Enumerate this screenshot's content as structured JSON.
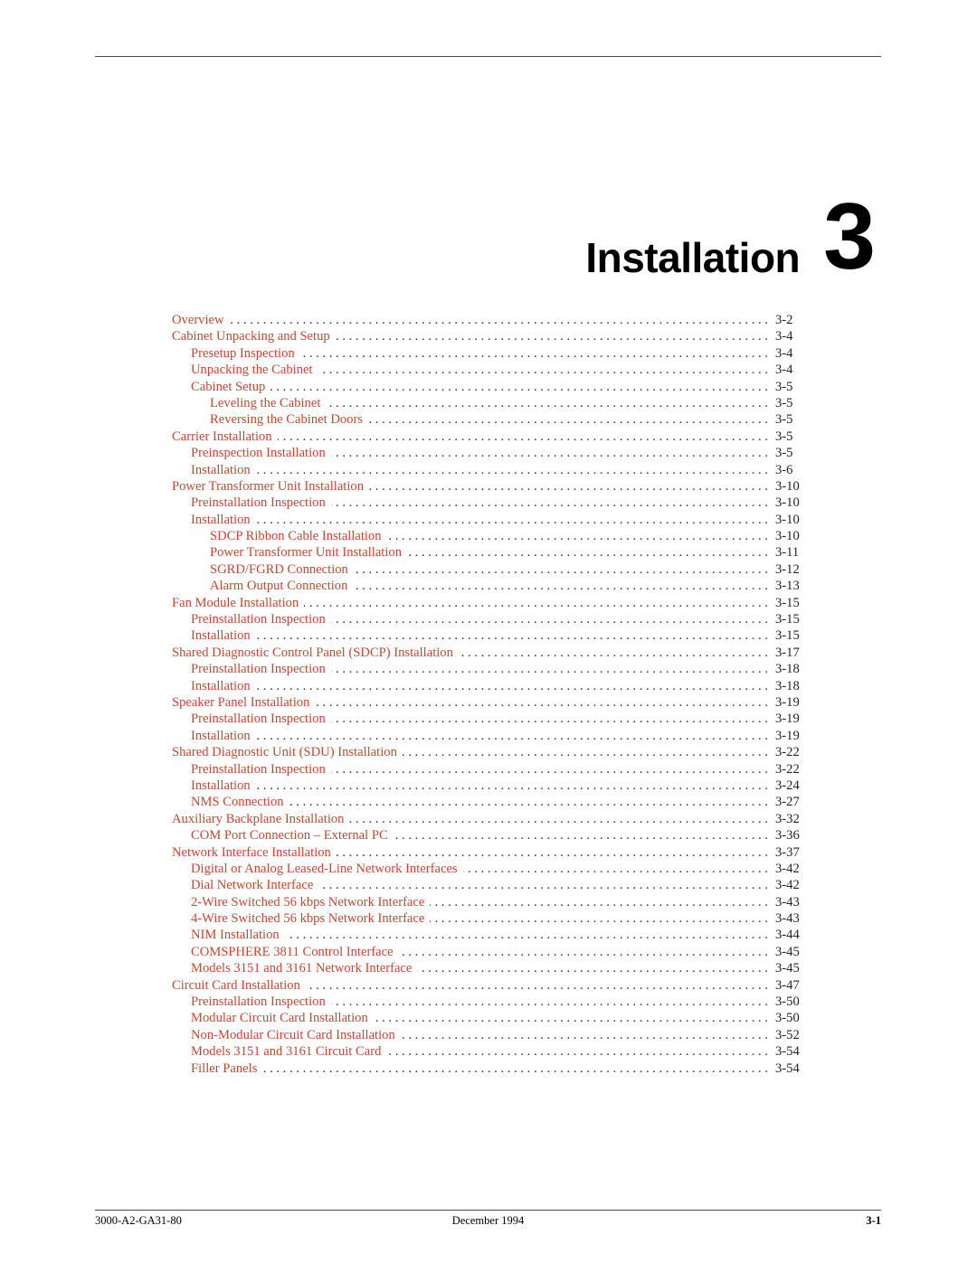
{
  "chapter": {
    "title": "Installation",
    "number": "3"
  },
  "toc": [
    {
      "level": 1,
      "label": "Overview",
      "page": "3-2"
    },
    {
      "level": 1,
      "label": "Cabinet Unpacking and Setup",
      "page": "3-4"
    },
    {
      "level": 2,
      "label": "Presetup Inspection",
      "page": "3-4"
    },
    {
      "level": 2,
      "label": "Unpacking the Cabinet",
      "page": "3-4"
    },
    {
      "level": 2,
      "label": "Cabinet Setup",
      "page": "3-5"
    },
    {
      "level": 3,
      "label": "Leveling the Cabinet",
      "page": "3-5"
    },
    {
      "level": 3,
      "label": "Reversing the Cabinet Doors",
      "page": "3-5"
    },
    {
      "level": 1,
      "label": "Carrier Installation",
      "page": "3-5"
    },
    {
      "level": 2,
      "label": "Preinspection Installation",
      "page": "3-5"
    },
    {
      "level": 2,
      "label": "Installation",
      "page": "3-6"
    },
    {
      "level": 1,
      "label": "Power Transformer Unit Installation",
      "page": "3-10"
    },
    {
      "level": 2,
      "label": "Preinstallation Inspection",
      "page": "3-10"
    },
    {
      "level": 2,
      "label": "Installation",
      "page": "3-10"
    },
    {
      "level": 3,
      "label": "SDCP Ribbon Cable Installation",
      "page": "3-10"
    },
    {
      "level": 3,
      "label": "Power Transformer Unit Installation",
      "page": "3-11"
    },
    {
      "level": 3,
      "label": "SGRD/FGRD Connection",
      "page": "3-12"
    },
    {
      "level": 3,
      "label": "Alarm Output Connection",
      "page": "3-13"
    },
    {
      "level": 1,
      "label": "Fan Module Installation",
      "page": "3-15"
    },
    {
      "level": 2,
      "label": "Preinstallation Inspection",
      "page": "3-15"
    },
    {
      "level": 2,
      "label": "Installation",
      "page": "3-15"
    },
    {
      "level": 1,
      "label": "Shared Diagnostic Control Panel (SDCP) Installation",
      "page": "3-17"
    },
    {
      "level": 2,
      "label": "Preinstallation Inspection",
      "page": "3-18"
    },
    {
      "level": 2,
      "label": "Installation",
      "page": "3-18"
    },
    {
      "level": 1,
      "label": "Speaker Panel Installation",
      "page": "3-19"
    },
    {
      "level": 2,
      "label": "Preinstallation Inspection",
      "page": "3-19"
    },
    {
      "level": 2,
      "label": "Installation",
      "page": "3-19"
    },
    {
      "level": 1,
      "label": "Shared Diagnostic Unit (SDU) Installation",
      "page": "3-22"
    },
    {
      "level": 2,
      "label": "Preinstallation Inspection",
      "page": "3-22"
    },
    {
      "level": 2,
      "label": "Installation",
      "page": "3-24"
    },
    {
      "level": 2,
      "label": "NMS Connection",
      "page": "3-27"
    },
    {
      "level": 1,
      "label": "Auxiliary Backplane Installation",
      "page": "3-32"
    },
    {
      "level": 2,
      "label": "COM Port Connection – External PC",
      "page": "3-36"
    },
    {
      "level": 1,
      "label": "Network Interface Installation",
      "page": "3-37"
    },
    {
      "level": 2,
      "label": "Digital or Analog Leased-Line Network Interfaces",
      "page": "3-42"
    },
    {
      "level": 2,
      "label": "Dial Network Interface",
      "page": "3-42"
    },
    {
      "level": 2,
      "label": "2-Wire Switched 56 kbps Network Interface",
      "page": "3-43"
    },
    {
      "level": 2,
      "label": "4-Wire Switched 56 kbps Network Interface",
      "page": "3-43"
    },
    {
      "level": 2,
      "label": "NIM Installation",
      "page": "3-44"
    },
    {
      "level": 2,
      "label": "COMSPHERE 3811 Control Interface",
      "page": "3-45"
    },
    {
      "level": 2,
      "label": "Models 3151 and 3161 Network Interface",
      "page": "3-45"
    },
    {
      "level": 1,
      "label": "Circuit Card Installation",
      "page": "3-47"
    },
    {
      "level": 2,
      "label": "Preinstallation Inspection",
      "page": "3-50"
    },
    {
      "level": 2,
      "label": "Modular Circuit Card Installation",
      "page": "3-50"
    },
    {
      "level": 2,
      "label": "Non-Modular Circuit Card Installation",
      "page": "3-52"
    },
    {
      "level": 2,
      "label": "Models 3151 and 3161 Circuit Card",
      "page": "3-54"
    },
    {
      "level": 2,
      "label": "Filler Panels",
      "page": "3-54"
    }
  ],
  "footer": {
    "document_number": "3000-A2-GA31-80",
    "date": "December 1994",
    "page_number": "3-1"
  },
  "colors": {
    "link": "#c8452f",
    "text": "#000000"
  }
}
